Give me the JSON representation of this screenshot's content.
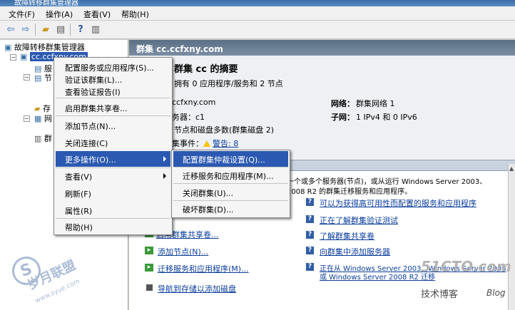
{
  "window": {
    "title": "故障转移群集管理器"
  },
  "menubar": {
    "items": [
      "文件(F)",
      "操作(A)",
      "查看(V)",
      "帮助(H)"
    ]
  },
  "tree": {
    "root": "故障转移群集管理器",
    "cluster": "cc.ccfxny.com",
    "children": [
      "服",
      "节",
      "存",
      "网",
      "群"
    ]
  },
  "main": {
    "header": "群集 cc.ccfxny.com",
    "summary_title": "群集 cc 的摘要",
    "summary_subtitle": "拥有 0 应用程序/服务和 2 节点",
    "name_value": "ccfxny.com",
    "server_label": "务器：c1",
    "quorum": "节点和磁盘多数(群集磁盘 2)",
    "events_label": "集事件：",
    "warning_link": "警告: 8",
    "network_label": "网络：",
    "network_value": "群集网络 1",
    "subnet_label": "子网：",
    "subnet_value": "1 IPv4 和 0 IPv6",
    "desc_line1": "一个或多个服务器(节点)，或从运行 Windows Server 2003、",
    "desc_line2": "2008 R2 的群集迁移服务和应用程序。",
    "left_links": [
      "启用群集共享卷...",
      "添加节点(N)...",
      "迁移服务和应用程序(M)...",
      "导航到存储以添加磁盘"
    ],
    "right_links": [
      "可以为获得高可用性而配置的服务和应用程序",
      "正在了解群集验证测试",
      "了解群集共享卷",
      "向群集中添加服务器",
      "正在从 Windows Server 2003、Windows Server 2008",
      "或 Windows Server 2008 R2 迁移"
    ]
  },
  "context_menu": {
    "items": [
      "配置服务或应用程序(S)...",
      "验证该群集(L)...",
      "查看验证报告(I)",
      "启用群集共享卷...",
      "添加节点(N)...",
      "关闭连接(C)",
      "更多操作(O)...",
      "查看(V)",
      "刷新(F)",
      "属性(R)",
      "帮助(H)"
    ],
    "highlighted": "更多操作(O)..."
  },
  "submenu": {
    "items": [
      "配置群集仲裁设置(Q)...",
      "迁移服务和应用程序(M)...",
      "关闭群集(U)...",
      "破坏群集(D)..."
    ],
    "highlighted": "配置群集仲裁设置(Q)..."
  },
  "watermarks": {
    "left_text": "岁月联盟",
    "left_url": "www.syue.com",
    "right_brand": "51CTO.com",
    "right_sub": "技术博客",
    "right_blog": "Blog"
  },
  "colors": {
    "highlight": "#2b59b1",
    "link": "#0b3e9b",
    "header": "#5b6f85"
  }
}
